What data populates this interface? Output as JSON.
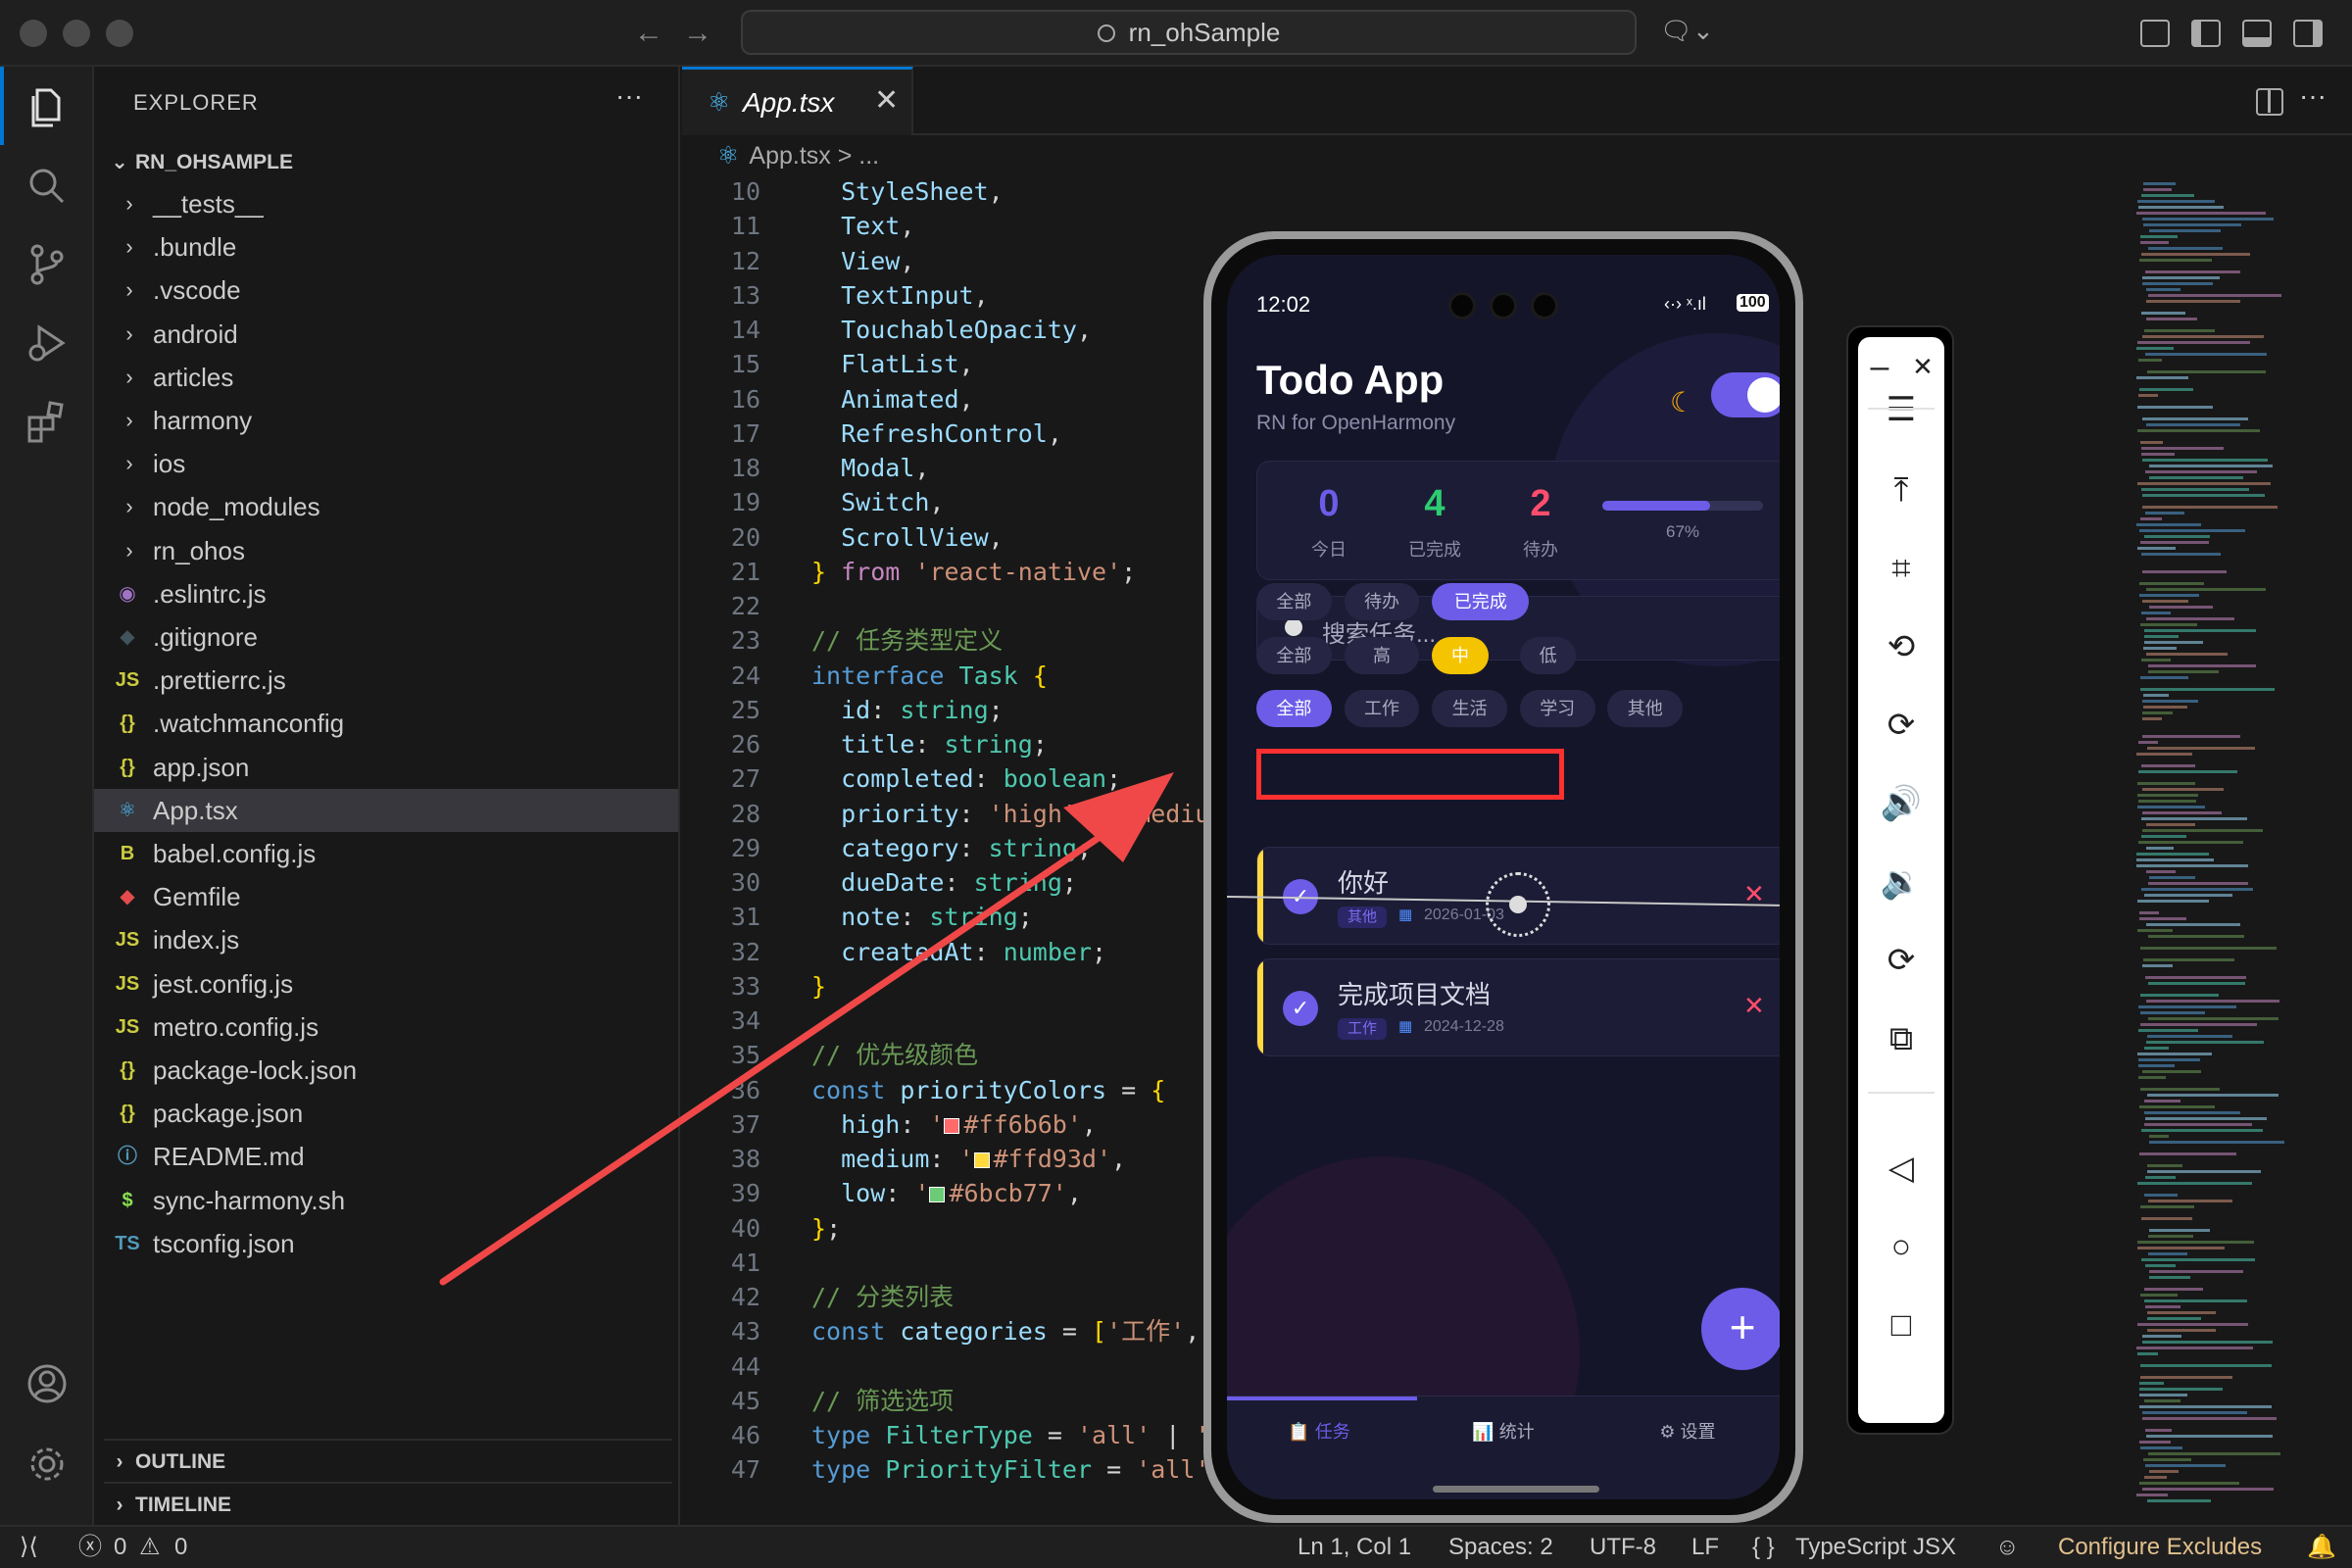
{
  "window": {
    "search_text": "rn_ohSample"
  },
  "sidebar": {
    "title": "EXPLORER",
    "more": "···",
    "root": "RN_OHSAMPLE",
    "items": [
      {
        "label": "__tests__",
        "type": "folder"
      },
      {
        "label": ".bundle",
        "type": "folder"
      },
      {
        "label": ".vscode",
        "type": "folder"
      },
      {
        "label": "android",
        "type": "folder"
      },
      {
        "label": "articles",
        "type": "folder"
      },
      {
        "label": "harmony",
        "type": "folder"
      },
      {
        "label": "ios",
        "type": "folder"
      },
      {
        "label": "node_modules",
        "type": "folder"
      },
      {
        "label": "rn_ohos",
        "type": "folder"
      },
      {
        "label": ".eslintrc.js",
        "icon": "◉",
        "color": "#a074c4"
      },
      {
        "label": ".gitignore",
        "icon": "◆",
        "color": "#41535b"
      },
      {
        "label": ".prettierrc.js",
        "icon": "JS",
        "color": "#cbcb41"
      },
      {
        "label": ".watchmanconfig",
        "icon": "{}",
        "color": "#cbcb41"
      },
      {
        "label": "app.json",
        "icon": "{}",
        "color": "#cbcb41"
      },
      {
        "label": "App.tsx",
        "icon": "⚛",
        "color": "#4fc1ff",
        "selected": true
      },
      {
        "label": "babel.config.js",
        "icon": "B",
        "color": "#cbcb41"
      },
      {
        "label": "Gemfile",
        "icon": "◆",
        "color": "#e34c4c"
      },
      {
        "label": "index.js",
        "icon": "JS",
        "color": "#cbcb41"
      },
      {
        "label": "jest.config.js",
        "icon": "JS",
        "color": "#cbcb41"
      },
      {
        "label": "metro.config.js",
        "icon": "JS",
        "color": "#cbcb41"
      },
      {
        "label": "package-lock.json",
        "icon": "{}",
        "color": "#cbcb41"
      },
      {
        "label": "package.json",
        "icon": "{}",
        "color": "#cbcb41"
      },
      {
        "label": "README.md",
        "icon": "ⓘ",
        "color": "#519aba"
      },
      {
        "label": "sync-harmony.sh",
        "icon": "$",
        "color": "#89e051"
      },
      {
        "label": "tsconfig.json",
        "icon": "TS",
        "color": "#519aba"
      }
    ],
    "outline": "OUTLINE",
    "timeline": "TIMELINE"
  },
  "editor": {
    "tab": "App.tsx",
    "breadcrumb": "App.tsx > ...",
    "lines": [
      {
        "n": "10",
        "h": "<span class='n'>  StyleSheet</span><span class='p'>,</span>"
      },
      {
        "n": "11",
        "h": "<span class='n'>  Text</span><span class='p'>,</span>"
      },
      {
        "n": "12",
        "h": "<span class='n'>  View</span><span class='p'>,</span>"
      },
      {
        "n": "13",
        "h": "<span class='n'>  TextInput</span><span class='p'>,</span>"
      },
      {
        "n": "14",
        "h": "<span class='n'>  TouchableOpacity</span><span class='p'>,</span>"
      },
      {
        "n": "15",
        "h": "<span class='n'>  FlatList</span><span class='p'>,</span>"
      },
      {
        "n": "16",
        "h": "<span class='n'>  Animated</span><span class='p'>,</span>"
      },
      {
        "n": "17",
        "h": "<span class='n'>  RefreshControl</span><span class='p'>,</span>"
      },
      {
        "n": "18",
        "h": "<span class='n'>  Modal</span><span class='p'>,</span>"
      },
      {
        "n": "19",
        "h": "<span class='n'>  Switch</span><span class='p'>,</span>"
      },
      {
        "n": "20",
        "h": "<span class='n'>  ScrollView</span><span class='p'>,</span>"
      },
      {
        "n": "21",
        "h": "<span class='br'>}</span> <span class='kc'>from</span> <span class='s'>'react-native'</span><span class='p'>;</span>"
      },
      {
        "n": "22",
        "h": ""
      },
      {
        "n": "23",
        "h": "<span class='c'>// 任务类型定义</span>"
      },
      {
        "n": "24",
        "h": "<span class='k'>interface</span> <span class='t'>Task</span> <span class='br'>{</span>"
      },
      {
        "n": "25",
        "h": "<span class='n'>  id</span><span class='p'>: </span><span class='t'>string</span><span class='p'>;</span>"
      },
      {
        "n": "26",
        "h": "<span class='n'>  title</span><span class='p'>: </span><span class='t'>string</span><span class='p'>;</span>"
      },
      {
        "n": "27",
        "h": "<span class='n'>  completed</span><span class='p'>: </span><span class='t'>boolean</span><span class='p'>;</span>"
      },
      {
        "n": "28",
        "h": "<span class='n'>  priority</span><span class='p'>: </span><span class='s'>'high'</span><span class='p'> | </span><span class='s'>'medium'</span>"
      },
      {
        "n": "29",
        "h": "<span class='n'>  category</span><span class='p'>: </span><span class='t'>string</span><span class='p'>;</span>"
      },
      {
        "n": "30",
        "h": "<span class='n'>  dueDate</span><span class='p'>: </span><span class='t'>string</span><span class='p'>;</span>"
      },
      {
        "n": "31",
        "h": "<span class='n'>  note</span><span class='p'>: </span><span class='t'>string</span><span class='p'>;</span>"
      },
      {
        "n": "32",
        "h": "<span class='n'>  createdAt</span><span class='p'>: </span><span class='t'>number</span><span class='p'>;</span>"
      },
      {
        "n": "33",
        "h": "<span class='br'>}</span>"
      },
      {
        "n": "34",
        "h": ""
      },
      {
        "n": "35",
        "h": "<span class='c'>// 优先级颜色</span>"
      },
      {
        "n": "36",
        "h": "<span class='k'>const</span> <span class='n'>priorityColors</span> <span class='p'>= </span><span class='br'>{</span>"
      },
      {
        "n": "37",
        "h": "<span class='n'>  high</span><span class='p'>: </span><span class='s'>'<i class='sw' style='background:#ff6b6b'></i>#ff6b6b'</span><span class='p'>,</span>"
      },
      {
        "n": "38",
        "h": "<span class='n'>  medium</span><span class='p'>: </span><span class='s'>'<i class='sw' style='background:#ffd93d'></i>#ffd93d'</span><span class='p'>,</span>"
      },
      {
        "n": "39",
        "h": "<span class='n'>  low</span><span class='p'>: </span><span class='s'>'<i class='sw' style='background:#6bcb77'></i>#6bcb77'</span><span class='p'>,</span>"
      },
      {
        "n": "40",
        "h": "<span class='br'>}</span><span class='p'>;</span>"
      },
      {
        "n": "41",
        "h": ""
      },
      {
        "n": "42",
        "h": "<span class='c'>// 分类列表</span>"
      },
      {
        "n": "43",
        "h": "<span class='k'>const</span> <span class='n'>categories</span> <span class='p'>= </span><span class='br'>[</span><span class='s'>'工作'</span><span class='p'>, </span><span class='s'>'生活'</span>"
      },
      {
        "n": "44",
        "h": ""
      },
      {
        "n": "45",
        "h": "<span class='c'>// 筛选选项</span>"
      },
      {
        "n": "46",
        "h": "<span class='k'>type</span> <span class='t'>FilterType</span> <span class='p'>= </span><span class='s'>'all'</span><span class='p'> | </span><span class='s'>'active'</span>"
      },
      {
        "n": "47",
        "h": "<span class='k'>type</span> <span class='t'>PriorityFilter</span> <span class='p'>= </span><span class='s'>'all'</span><span class='p'> | </span><span class='s'>'high'</span>"
      }
    ]
  },
  "phone": {
    "time": "12:02",
    "status_icons": "‹·› ˣ.ıl",
    "battery": "100",
    "title": "Todo App",
    "subtitle": "RN for OpenHarmony",
    "stats": [
      {
        "value": "0",
        "label": "今日",
        "color": "#6c5ce7"
      },
      {
        "value": "4",
        "label": "已完成",
        "color": "#2ecc71"
      },
      {
        "value": "2",
        "label": "待办",
        "color": "#ff4d6d"
      }
    ],
    "progress": {
      "value": 0.67,
      "label": "67%"
    },
    "search_placeholder": "搜索任务...",
    "status_filters": [
      {
        "label": "全部",
        "on": false
      },
      {
        "label": "待办",
        "on": false
      },
      {
        "label": "已完成",
        "on": true
      }
    ],
    "priority_filters": [
      {
        "label": "全部",
        "on": false
      },
      {
        "label": "高",
        "on": false
      },
      {
        "label": "中",
        "on": "yellow"
      },
      {
        "label": "低",
        "on": false
      }
    ],
    "category_filters": [
      {
        "label": "全部",
        "on": true
      },
      {
        "label": "工作",
        "on": false
      },
      {
        "label": "生活",
        "on": false
      },
      {
        "label": "学习",
        "on": false
      },
      {
        "label": "其他",
        "on": false
      }
    ],
    "tasks": [
      {
        "title": "你好",
        "category": "其他",
        "date": "2026-01-03"
      },
      {
        "title": "完成项目文档",
        "category": "工作",
        "date": "2024-12-28"
      }
    ],
    "fab": "+",
    "bottom_tabs": [
      {
        "label": "📋 任务",
        "on": true
      },
      {
        "label": "📊 统计",
        "on": false
      },
      {
        "label": "⚙ 设置",
        "on": false
      }
    ]
  },
  "emulator": {
    "buttons": [
      "–",
      "✕",
      "☰",
      "⤒",
      "⌗",
      "⟲",
      "⟳",
      "🔊",
      "🔉",
      "⟳",
      "⧉",
      "◁",
      "○",
      "□"
    ]
  },
  "statusbar": {
    "errors": "0",
    "warnings": "0",
    "position": "Ln 1, Col 1",
    "spaces": "Spaces: 2",
    "encoding": "UTF-8",
    "eol": "LF",
    "language": "TypeScript JSX",
    "configure": "Configure Excludes"
  },
  "colors": {
    "accent": "#6c5ce7",
    "vscode_blue": "#0078d4",
    "annotation_red": "#f04848"
  }
}
